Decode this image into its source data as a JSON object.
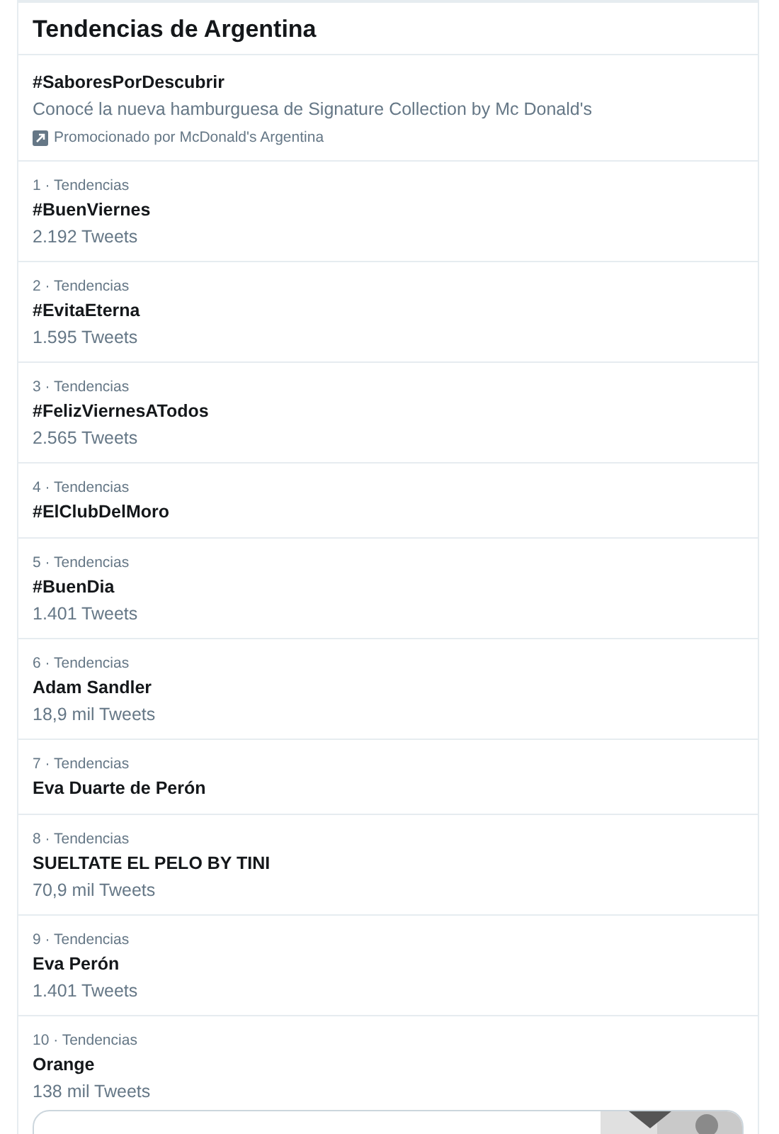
{
  "title": "Tendencias de Argentina",
  "promoted": {
    "name": "#SaboresPorDescubrir",
    "description": "Conocé la nueva hamburguesa de Signature Collection by Mc Donald's",
    "sponsor": "Promocionado por McDonald's Argentina"
  },
  "trends": [
    {
      "context": "1 · Tendencias",
      "name": "#BuenViernes",
      "count": "2.192 Tweets"
    },
    {
      "context": "2 · Tendencias",
      "name": "#EvitaEterna",
      "count": "1.595 Tweets"
    },
    {
      "context": "3 · Tendencias",
      "name": "#FelizViernesATodos",
      "count": "2.565 Tweets"
    },
    {
      "context": "4 · Tendencias",
      "name": "#ElClubDelMoro"
    },
    {
      "context": "5 · Tendencias",
      "name": "#BuenDia",
      "count": "1.401 Tweets"
    },
    {
      "context": "6 · Tendencias",
      "name": "Adam Sandler",
      "count": "18,9 mil Tweets"
    },
    {
      "context": "7 · Tendencias",
      "name": "Eva Duarte de Perón"
    },
    {
      "context": "8 · Tendencias",
      "name": "SUELTATE EL PELO BY TINI",
      "count": "70,9 mil Tweets"
    },
    {
      "context": "9 · Tendencias",
      "name": "Eva Perón",
      "count": "1.401 Tweets"
    },
    {
      "context": "10 · Tendencias",
      "name": "Orange",
      "count": "138 mil Tweets"
    }
  ]
}
